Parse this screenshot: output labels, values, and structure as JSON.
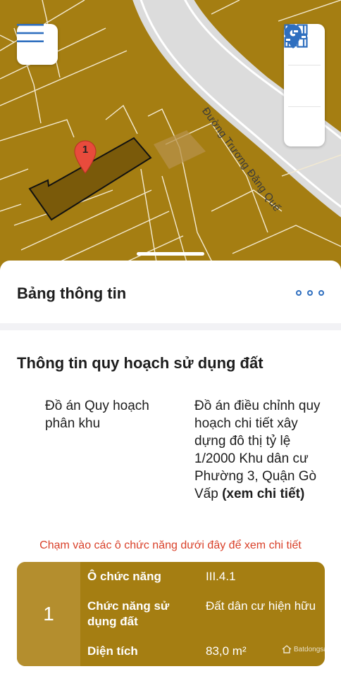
{
  "map": {
    "street_name": "Đường Trương Đăng Quế",
    "marker_number": "1",
    "colors": {
      "land": "#a57e12",
      "road": "#e3e3e3",
      "selected_plot": "#7a5a0a"
    }
  },
  "map_controls": {
    "menu_icon": "hamburger-menu-icon",
    "layers_icon": "grid-layers-icon",
    "location_icon": "location-pin-icon",
    "filter_icon": "sliders-icon"
  },
  "panel": {
    "title": "Bảng thông tin",
    "more_icon": "more-options-icon",
    "section_title": "Thông tin quy hoạch sử dụng đất",
    "plan_label": "Đồ án Quy hoạch phân khu",
    "plan_value": "Đồ án điều chỉnh quy hoạch chi tiết xây dựng đô thị tỷ lệ 1/2000 Khu dân cư Phường 3, Quận Gò Vấp",
    "plan_link": "(xem chi tiết)",
    "hint": "Chạm vào các ô chức năng dưới đây để xem chi tiết"
  },
  "card": {
    "id": "1",
    "rows": [
      {
        "key": "Ô chức năng",
        "value": "III.4.1"
      },
      {
        "key": "Chức năng sử dụng đất",
        "value": "Đất dân cư hiện hữu"
      },
      {
        "key": "Diện tích",
        "value": "83,0 m²"
      }
    ],
    "watermark": "Batdongsan",
    "colors": {
      "background": "#a57e12",
      "id_cell": "#b48e2e",
      "text": "#ffffff"
    }
  },
  "colors": {
    "accent": "#2f6fbf",
    "hint": "#d9412a"
  }
}
